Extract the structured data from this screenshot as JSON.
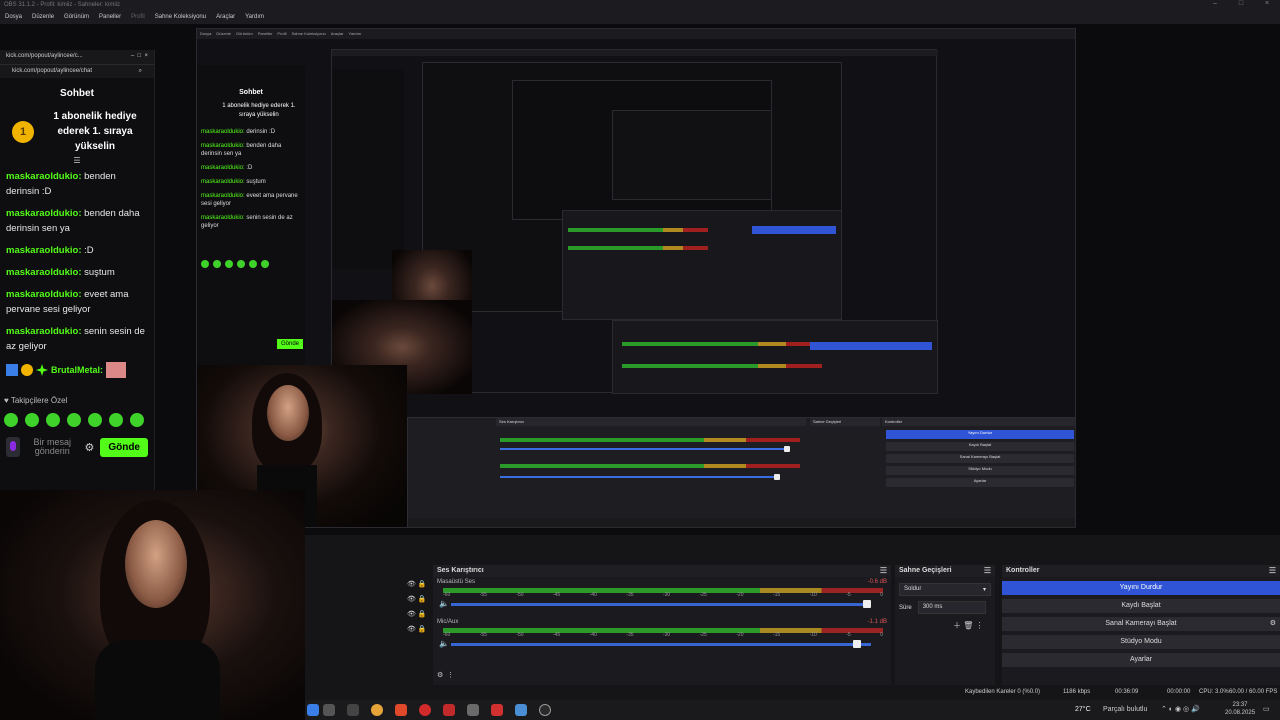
{
  "window": {
    "title": "OBS 31.1.2 - Profil: kimiiz - Sahneler: kimiiz"
  },
  "menubar": {
    "items": [
      "Dosya",
      "Düzenle",
      "Görünüm",
      "Paneller",
      "Profil",
      "Sahne Koleksiyonu",
      "Araçlar",
      "Yardım"
    ]
  },
  "chat": {
    "url": "kick.com/popout/aylincee/chat",
    "url_short": "kick.com/popout/aylincee/c...",
    "heading": "Sohbet",
    "pinned_icon": "1",
    "pinned_text": "1 abonelik hediye ederek 1. sıraya yükselin",
    "messages": [
      {
        "user": "maskaraoldukio:",
        "text": " benden derinsin :D"
      },
      {
        "user": "maskaraoldukio:",
        "text": " benden daha derinsin sen ya"
      },
      {
        "user": "maskaraoldukio:",
        "text": " :D"
      },
      {
        "user": "maskaraoldukio:",
        "text": " suştum"
      },
      {
        "user": "maskaraoldukio:",
        "text": " eveet ama pervane sesi geliyor"
      },
      {
        "user": "maskaraoldukio:",
        "text": " senin sesin de az geliyor"
      }
    ],
    "badge_user": "BrutalMetal:",
    "followers_label": "♥ Takipçilere Özel",
    "input_placeholder": "Bir mesaj gönderin",
    "send_label": "Gönde"
  },
  "mixer": {
    "title": "Ses Karıştırıcı",
    "tracks": [
      {
        "name": "Masaüstü Ses",
        "db": "-0.6 dB",
        "volume_pct": 99
      },
      {
        "name": "Mic/Aux",
        "db": "-1.1 dB",
        "volume_pct": 97
      }
    ],
    "ticks": [
      "-60",
      "-55",
      "-50",
      "-45",
      "-40",
      "-35",
      "-30",
      "-25",
      "-20",
      "-15",
      "-10",
      "-5",
      "0"
    ]
  },
  "transitions": {
    "title": "Sahne Geçişleri",
    "selected": "Soldur",
    "duration_label": "Süre",
    "duration_value": "300 ms"
  },
  "controls": {
    "title": "Kontroller",
    "buttons": [
      "Yayını Durdur",
      "Kaydı Başlat",
      "Sanal Kamerayı Başlat",
      "Stüdyo Modu",
      "Ayarlar"
    ]
  },
  "status": {
    "dropped": "Kaybedilen Kareler 0 (%0.0)",
    "bitrate": "1186 kbps",
    "live_time": "00:36:09",
    "rec_time": "00:00:00",
    "cpu": "CPU: 3.0%",
    "fps": "60.00 / 60.00 FPS"
  },
  "taskbar": {
    "weather": "27°C",
    "weather_desc": "Parçalı bulutlu",
    "time": "23:37",
    "date": "20.08.2025"
  },
  "colors": {
    "kick_green": "#53fc18",
    "accent_blue": "#2f54d6",
    "gold": "#f0b400"
  }
}
